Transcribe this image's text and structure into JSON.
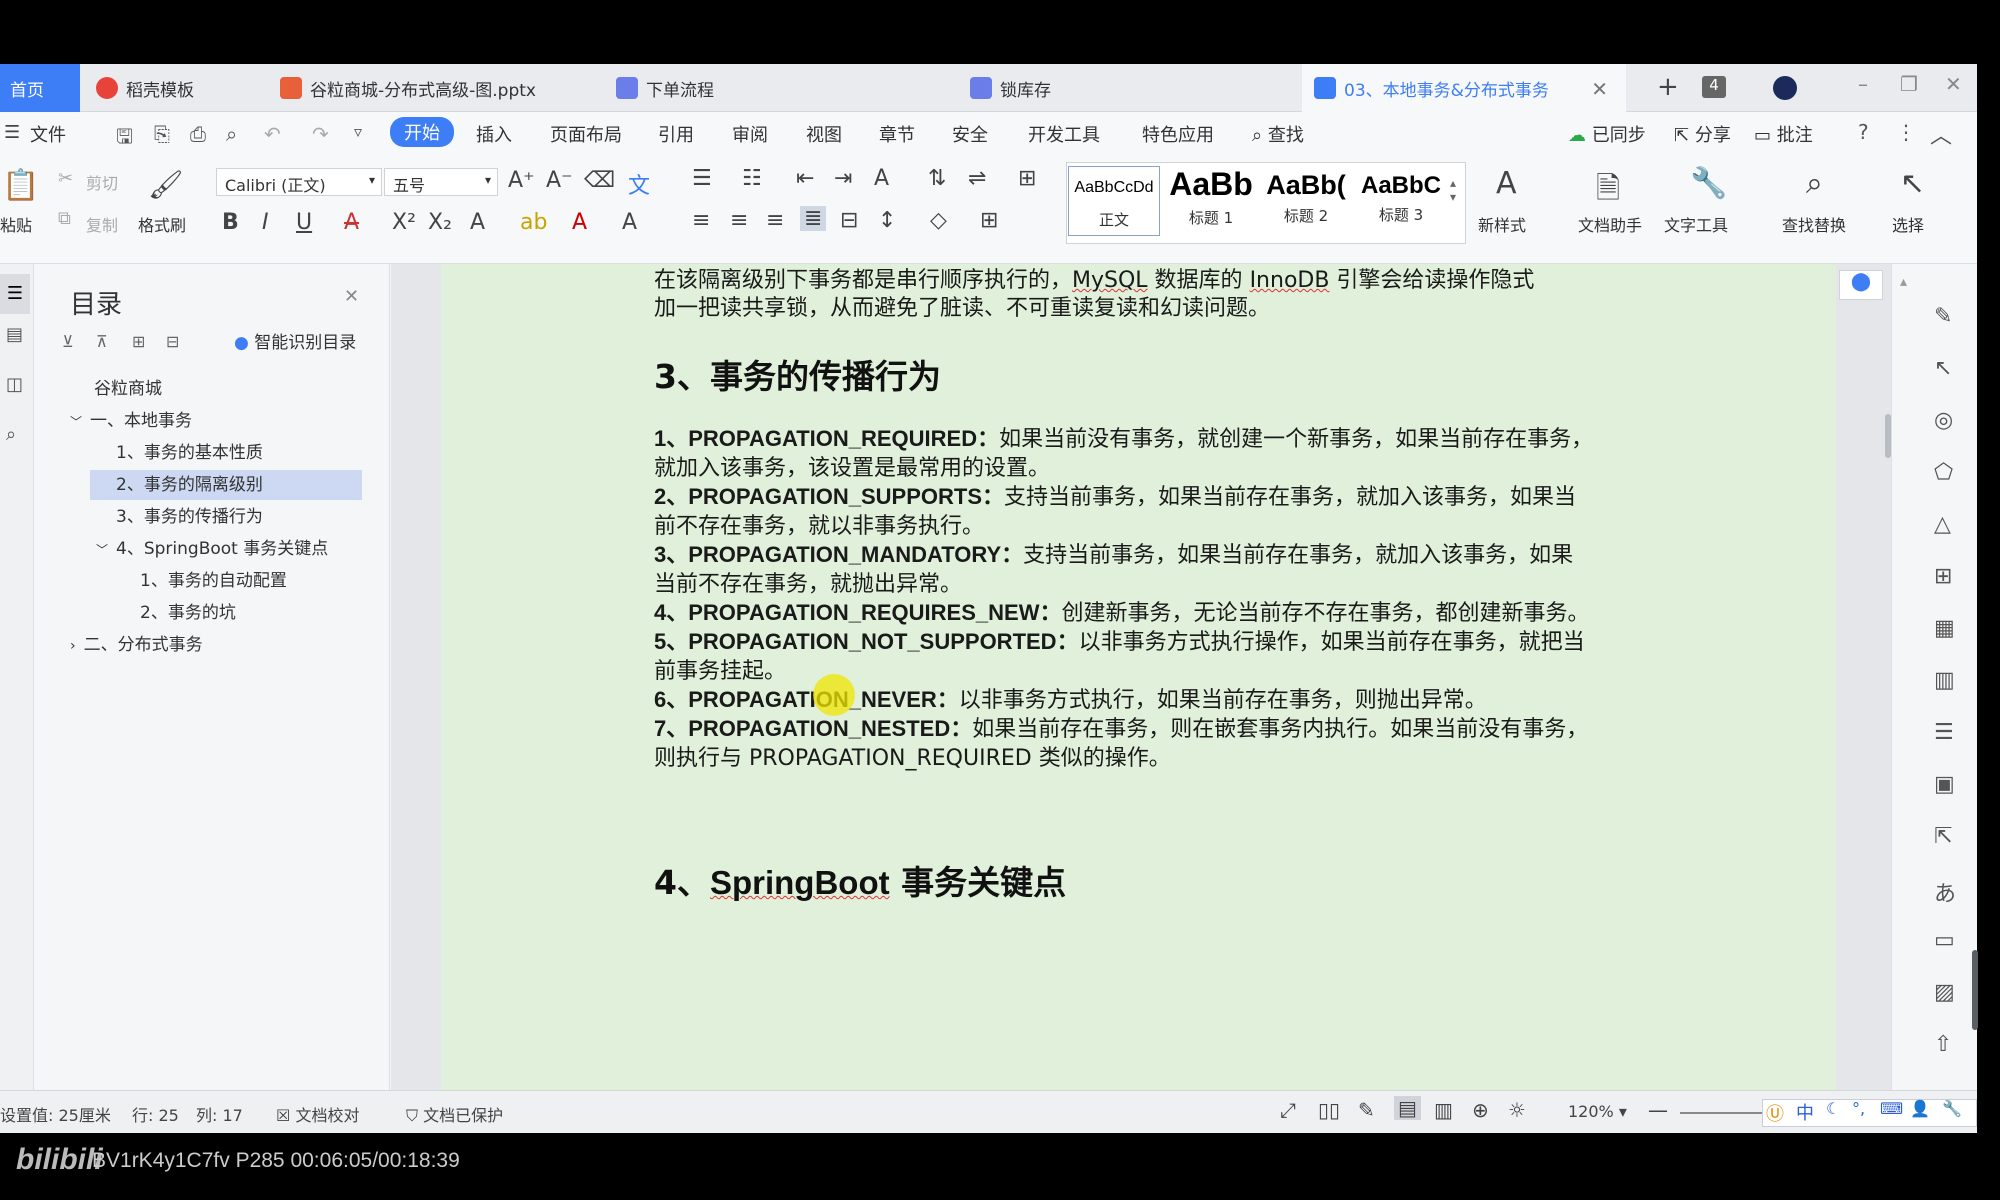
{
  "tabs": [
    {
      "label": "首页"
    },
    {
      "label": "稻壳模板"
    },
    {
      "label": "谷粒商城-分布式高级-图.pptx"
    },
    {
      "label": "下单流程"
    },
    {
      "label": "锁库存"
    },
    {
      "label": "03、本地事务&分布式事务"
    }
  ],
  "tab_counter": "4",
  "menu": {
    "file": "文件",
    "items": [
      "开始",
      "插入",
      "页面布局",
      "引用",
      "审阅",
      "视图",
      "章节",
      "安全",
      "开发工具",
      "特色应用"
    ],
    "search": "查找",
    "sync": "已同步",
    "share": "分享",
    "review": "批注"
  },
  "ribbon": {
    "paste": "粘贴",
    "cut": "剪切",
    "copy": "复制",
    "format_painter": "格式刷",
    "font_name": "Calibri (正文)",
    "font_size": "五号",
    "styles": [
      {
        "sample": "AaBbCcDd",
        "name": "正文"
      },
      {
        "sample": "AaBb",
        "name": "标题 1"
      },
      {
        "sample": "AaBb(",
        "name": "标题 2"
      },
      {
        "sample": "AaBbC",
        "name": "标题 3"
      }
    ],
    "new_style": "新样式",
    "doc_assistant": "文档助手",
    "text_tools": "文字工具",
    "find_replace": "查找替换",
    "select": "选择"
  },
  "toc": {
    "title": "目录",
    "smart": "智能识别目录",
    "items": [
      {
        "label": "谷粒商城"
      },
      {
        "label": "一、本地事务"
      },
      {
        "label": "1、事务的基本性质"
      },
      {
        "label": "2、事务的隔离级别"
      },
      {
        "label": "3、事务的传播行为"
      },
      {
        "label": "4、SpringBoot 事务关键点"
      },
      {
        "label": "1、事务的自动配置"
      },
      {
        "label": "2、事务的坑"
      },
      {
        "label": "二、分布式事务"
      }
    ]
  },
  "doc": {
    "top_line1_a": "在该隔离级别下事务都是串行顺序执行的，",
    "top_line1_mysql": "MySQL",
    "top_line1_b": " 数据库的 ",
    "top_line1_innodb": "InnoDB",
    "top_line1_c": " 引擎会给读操作隐式",
    "top_line2": "加一把读共享锁，从而避免了脏读、不可重读复读和幻读问题。",
    "heading3": "3、事务的传播行为",
    "p1_key": "1、PROPAGATION_REQUIRED：",
    "p1_text": "如果当前没有事务，就创建一个新事务，如果当前存在事务，",
    "p1_text2": "就加入该事务，该设置是最常用的设置。",
    "p2_key": "2、PROPAGATION_SUPPORTS：",
    "p2_text": "支持当前事务，如果当前存在事务，就加入该事务，如果当",
    "p2_text2": "前不存在事务，就以非事务执行。",
    "p3_key": "3、PROPAGATION_MANDATORY：",
    "p3_text": "支持当前事务，如果当前存在事务，就加入该事务，如果",
    "p3_text2": "当前不存在事务，就抛出异常。",
    "p4_key": "4、PROPAGATION_REQUIRES_NEW：",
    "p4_text": "创建新事务，无论当前存不存在事务，都创建新事务。",
    "p5_key": "5、PROPAGATION_NOT_SUPPORTED：",
    "p5_text": "以非事务方式执行操作，如果当前存在事务，就把当",
    "p5_text2": "前事务挂起。",
    "p6_key": "6、PROPAGATION_NEVER：",
    "p6_text": "以非事务方式执行，如果当前存在事务，则抛出异常。",
    "p7_key": "7、PROPAGATION_NESTED：",
    "p7_text": "如果当前存在事务，则在嵌套事务内执行。如果当前没有事务，",
    "p7_text2": "则执行与 PROPAGATION_REQUIRED 类似的操作。",
    "heading4_num": "4、",
    "heading4_a": "SpringBoot",
    "heading4_b": " 事务关键点"
  },
  "status": {
    "setting": "设置值: 25厘米",
    "row": "行: 25",
    "col": "列: 17",
    "proof": "文档校对",
    "protected": "文档已保护",
    "zoom": "120%"
  },
  "ime": {
    "lang": "中"
  },
  "footer": {
    "video_info": "BV1rK4y1C7fv P285 00:06:05/00:18:39"
  },
  "colors": {
    "accent": "#3d7df5",
    "page_bg": "#e0f0da",
    "selection": "#cdd9f3"
  }
}
